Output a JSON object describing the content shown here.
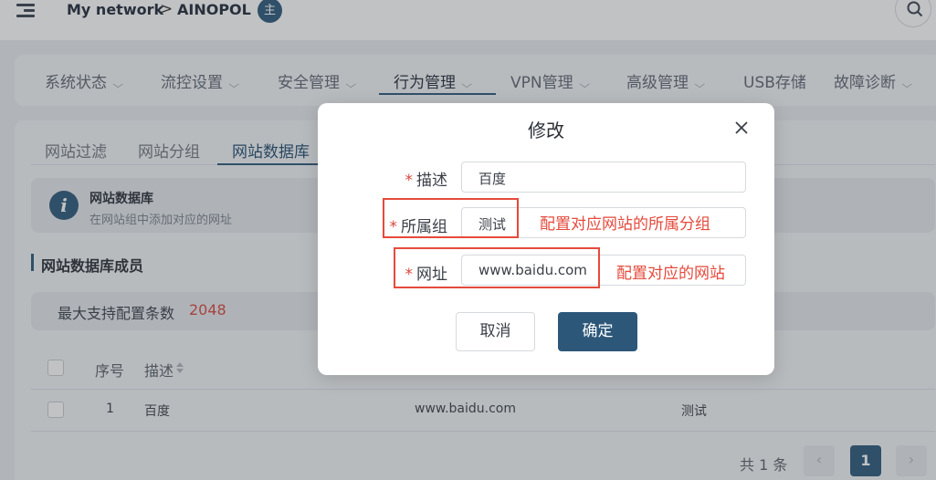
{
  "header": {
    "network_label": "My network",
    "separator": ">",
    "device_name": "AINOPOL",
    "owner_badge": "主"
  },
  "nav": {
    "items": [
      {
        "label": "系统状态",
        "has_menu": true
      },
      {
        "label": "流控设置",
        "has_menu": true
      },
      {
        "label": "安全管理",
        "has_menu": true
      },
      {
        "label": "行为管理",
        "has_menu": true
      },
      {
        "label": "VPN管理",
        "has_menu": true
      },
      {
        "label": "高级管理",
        "has_menu": true
      },
      {
        "label": "USB存储",
        "has_menu": false
      },
      {
        "label": "故障诊断",
        "has_menu": true
      }
    ],
    "active": "行为管理"
  },
  "subtabs": {
    "items": [
      "网站过滤",
      "网站分组",
      "网站数据库"
    ],
    "active": "网站数据库"
  },
  "info": {
    "title": "网站数据库",
    "desc": "在网站组中添加对应的网址"
  },
  "section": {
    "title": "网站数据库成员",
    "limit_label": "最大支持配置条数",
    "limit_value": "2048"
  },
  "table": {
    "columns": [
      "序号",
      "描述"
    ],
    "rows": [
      {
        "index": "1",
        "desc": "百度",
        "url": "www.baidu.com",
        "group": "测试"
      }
    ]
  },
  "pagination": {
    "total": "共 1 条",
    "prev": "‹",
    "current": "1",
    "next": "›"
  },
  "modal": {
    "title": "修改",
    "fields": {
      "desc": {
        "label": "描述",
        "value": "百度"
      },
      "group": {
        "label": "所属组",
        "value": "测试"
      },
      "url": {
        "label": "网址",
        "value": "www.baidu.com"
      }
    },
    "required_mark": "*",
    "annotations": {
      "group": "配置对应网站的所属分组",
      "url": "配置对应的网站"
    },
    "cancel_label": "取消",
    "confirm_label": "确定"
  },
  "colors": {
    "primary": "#2c5779",
    "danger": "#d9463b",
    "annotation": "#e54a3c"
  }
}
